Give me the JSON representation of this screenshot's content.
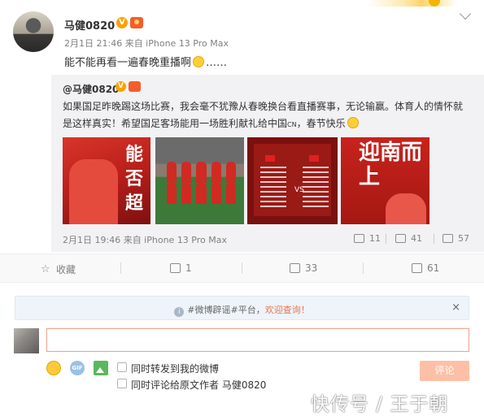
{
  "post": {
    "username": "马健0820",
    "verified_badge": "V",
    "meta": "2月1日 21:46 来自 iPhone 13 Pro Max",
    "text_before": "能不能再看一遍春晚重播啊",
    "text_after": "……"
  },
  "repost": {
    "author": "@马健0820",
    "verified_badge": "V",
    "line1": "如果国足昨晚踢这场比赛，我会毫不犹豫从春晚换台看直播赛事，无论输赢。体育人的情怀就",
    "line2": "是这样真实！希望国足客场能用一场胜利献礼给中国",
    "line2_suffix_small": "CN",
    "line2_tail": "，春节快乐",
    "images": [
      {
        "icon": "calligraphy-poster",
        "overlay_text": "能否超"
      },
      {
        "icon": "team-photo"
      },
      {
        "icon": "lineup-card",
        "overlay_text": "VS"
      },
      {
        "icon": "calligraphy-poster",
        "overlay_text": "迎南而上"
      }
    ],
    "meta": "2月1日 19:46 来自 iPhone 13 Pro Max",
    "stats": {
      "reposts": "11",
      "comments": "41",
      "likes": "57"
    }
  },
  "actions": {
    "favorite_label": "收藏",
    "repost_count": "1",
    "comment_count": "33",
    "like_count": "61"
  },
  "comment_box": {
    "notice_prefix": "#微博辟谣#平台，",
    "notice_link": "欢迎查询！",
    "close": "×",
    "input_value": "",
    "gif_label": "GIF",
    "option1": "同时转发到我的微博",
    "option2": "同时评论给原文作者 马健0820",
    "submit_label": "评论"
  },
  "watermark": "快传号 / 王于朝",
  "colors": {
    "accent": "#eb7350",
    "submit_bg": "#fdc0a6",
    "repost_bg": "#f2f2f5"
  }
}
